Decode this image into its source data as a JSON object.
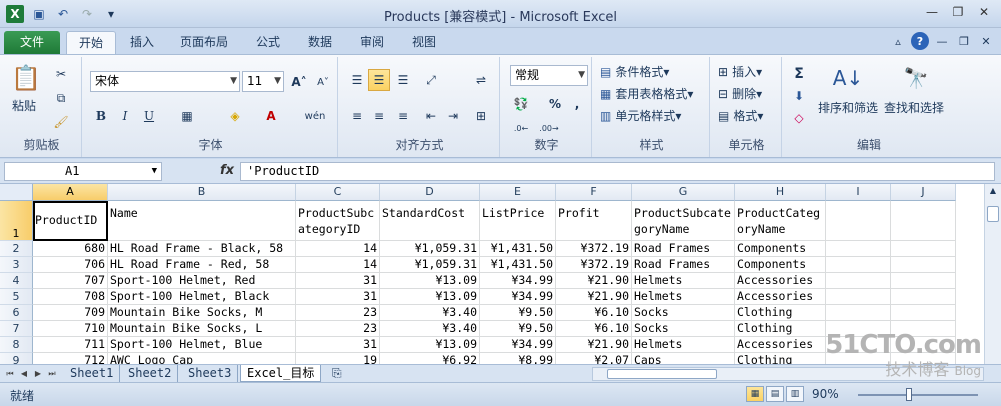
{
  "window": {
    "title": "Products  [兼容模式] - Microsoft Excel"
  },
  "ribbon_tabs": [
    "文件",
    "开始",
    "插入",
    "页面布局",
    "公式",
    "数据",
    "审阅",
    "视图"
  ],
  "groups": {
    "clipboard": {
      "label": "剪贴板",
      "paste": "粘贴"
    },
    "font": {
      "label": "字体",
      "name": "宋体",
      "size": "11",
      "bold": "B",
      "italic": "I",
      "underline": "U",
      "grow": "A",
      "shrink": "A"
    },
    "alignment": {
      "label": "对齐方式"
    },
    "number": {
      "label": "数字",
      "format": "常规",
      "percent": "%",
      "comma": ","
    },
    "styles": {
      "label": "样式",
      "conditional": "条件格式",
      "table": "套用表格格式",
      "cell": "单元格样式"
    },
    "cells": {
      "label": "单元格",
      "insert": "插入",
      "delete": "删除",
      "format": "格式"
    },
    "editing": {
      "label": "编辑",
      "sort": "排序和筛选",
      "find": "查找和选择",
      "sum": "Σ"
    }
  },
  "formula_bar": {
    "name_box": "A1",
    "fx": "fx",
    "value": "'ProductID"
  },
  "columns": [
    "A",
    "B",
    "C",
    "D",
    "E",
    "F",
    "G",
    "H",
    "I",
    "J"
  ],
  "rows": [
    "1",
    "2",
    "3",
    "4",
    "5",
    "6",
    "7",
    "8",
    "9"
  ],
  "headers": [
    "ProductID",
    "Name",
    "ProductSubcategoryID",
    "StandardCost",
    "ListPrice",
    "Profit",
    "ProductSubcategoryName",
    "ProductCategoryName"
  ],
  "data": [
    [
      "680",
      "HL Road Frame - Black, 58",
      "14",
      "¥1,059.31",
      "¥1,431.50",
      "¥372.19",
      "Road Frames",
      "Components"
    ],
    [
      "706",
      "HL Road Frame - Red, 58",
      "14",
      "¥1,059.31",
      "¥1,431.50",
      "¥372.19",
      "Road Frames",
      "Components"
    ],
    [
      "707",
      "Sport-100 Helmet, Red",
      "31",
      "¥13.09",
      "¥34.99",
      "¥21.90",
      "Helmets",
      "Accessories"
    ],
    [
      "708",
      "Sport-100 Helmet, Black",
      "31",
      "¥13.09",
      "¥34.99",
      "¥21.90",
      "Helmets",
      "Accessories"
    ],
    [
      "709",
      "Mountain Bike Socks, M",
      "23",
      "¥3.40",
      "¥9.50",
      "¥6.10",
      "Socks",
      "Clothing"
    ],
    [
      "710",
      "Mountain Bike Socks, L",
      "23",
      "¥3.40",
      "¥9.50",
      "¥6.10",
      "Socks",
      "Clothing"
    ],
    [
      "711",
      "Sport-100 Helmet, Blue",
      "31",
      "¥13.09",
      "¥34.99",
      "¥21.90",
      "Helmets",
      "Accessories"
    ],
    [
      "712",
      "AWC Logo Cap",
      "19",
      "¥6.92",
      "¥8.99",
      "¥2.07",
      "Caps",
      "Clothing"
    ]
  ],
  "sheets": [
    "Sheet1",
    "Sheet2",
    "Sheet3",
    "Excel_目标"
  ],
  "active_sheet": "Excel_目标",
  "status": {
    "mode": "就绪",
    "zoom": "90%"
  },
  "watermark": {
    "brand": "51CTO.com",
    "sub": "技术博客",
    "tag": "Blog"
  }
}
